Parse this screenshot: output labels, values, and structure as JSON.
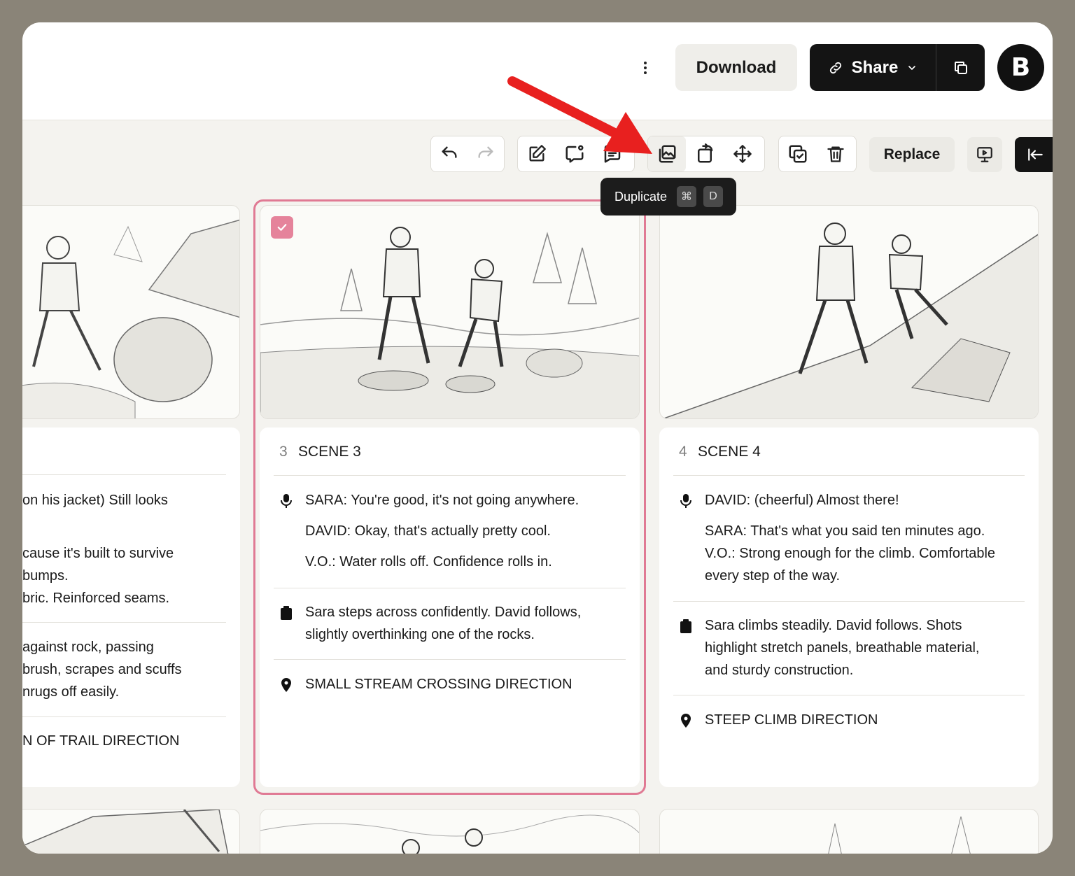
{
  "header": {
    "download_label": "Download",
    "share_label": "Share",
    "avatar_initial": "B"
  },
  "toolbar": {
    "replace_label": "Replace",
    "tooltip": {
      "label": "Duplicate",
      "key1": "⌘",
      "key2": "D"
    }
  },
  "cards": {
    "left": {
      "dialogue": [
        "on his jacket) Still looks",
        "cause it's built to survive",
        " bumps.",
        "bric. Reinforced seams."
      ],
      "action": [
        "against rock, passing",
        "brush, scrapes and scuffs",
        "nrugs off easily."
      ],
      "location": "N OF TRAIL DIRECTION"
    },
    "scene3": {
      "number": "3",
      "title": "SCENE 3",
      "dialogue": [
        "SARA: You're good, it's not going anywhere.",
        "DAVID: Okay, that's actually pretty cool.",
        "V.O.: Water rolls off. Confidence rolls in."
      ],
      "action": "Sara steps across confidently. David follows, slightly overthinking one of the rocks.",
      "location": "SMALL STREAM CROSSING DIRECTION"
    },
    "scene4": {
      "number": "4",
      "title": "SCENE 4",
      "dialogue1": "DAVID: (cheerful) Almost there!",
      "dialogue2": "SARA: That's what you said ten minutes ago. V.O.: Strong enough for the climb. Comfortable every step of the way.",
      "action": "Sara climbs steadily. David follows. Shots highlight stretch panels, breathable material, and sturdy construction.",
      "location": "STEEP CLIMB DIRECTION"
    }
  },
  "colors": {
    "selection": "#e07a94",
    "dark": "#141414",
    "arrow": "#e8201f"
  }
}
